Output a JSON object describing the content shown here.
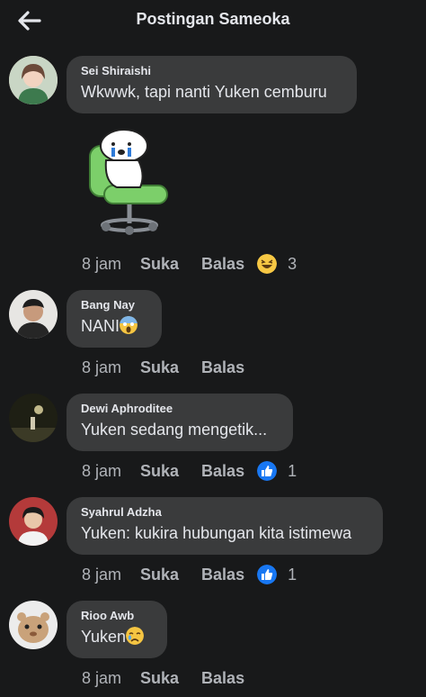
{
  "header": {
    "title": "Postingan Sameoka",
    "back_icon": "arrow-left-icon"
  },
  "colors": {
    "background": "#18191a",
    "bubble": "#3a3b3c",
    "like_blue": "#1877f2",
    "text": "#e4e6eb",
    "muted": "#b0b3b8"
  },
  "comments": [
    {
      "author": "Sei Shiraishi",
      "text": "Wkwwk, tapi nanti Yuken cemburu",
      "sticker": "chair-crying-sticker",
      "time": "8 jam",
      "like_label": "Suka",
      "reply_label": "Balas",
      "reaction": "haha-emoji",
      "reaction_count": "3"
    },
    {
      "author": "Bang Nay",
      "text": "NANI",
      "text_emoji": "screaming-emoji",
      "time": "8 jam",
      "like_label": "Suka",
      "reply_label": "Balas"
    },
    {
      "author": "Dewi Aphroditee",
      "text": "Yuken sedang mengetik...",
      "time": "8 jam",
      "like_label": "Suka",
      "reply_label": "Balas",
      "reaction": "like-emoji",
      "reaction_count": "1"
    },
    {
      "author": "Syahrul Adzha",
      "text": "Yuken: kukira hubungan kita istimewa",
      "time": "8 jam",
      "like_label": "Suka",
      "reply_label": "Balas",
      "reaction": "like-emoji",
      "reaction_count": "1"
    },
    {
      "author": "Rioo Awb",
      "text": "Yuken",
      "text_emoji": "crying-emoji",
      "time": "8 jam",
      "like_label": "Suka",
      "reply_label": "Balas"
    }
  ]
}
